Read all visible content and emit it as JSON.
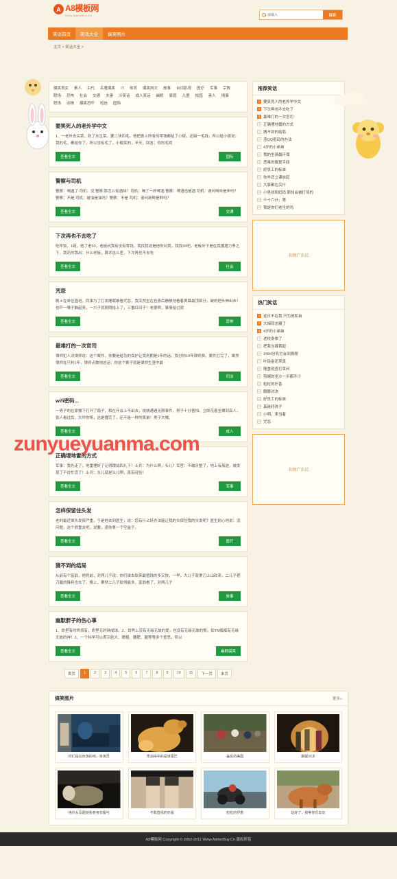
{
  "site": {
    "logo_initial": "A",
    "logo_title": "A8模板网",
    "logo_sub": "Www.AdminBuy.Cn",
    "watermark": "zunyueyuanma.com"
  },
  "search": {
    "placeholder": "请输入",
    "button": "搜索"
  },
  "nav": [
    {
      "label": "笑话首页",
      "active": false
    },
    {
      "label": "笑话大全",
      "active": true
    },
    {
      "label": "搞笑图片",
      "active": false
    }
  ],
  "breadcrumb": "主页 > 笑话大全 >",
  "categories": [
    "爆笑男女",
    "素人",
    "古代",
    "名著爆笑",
    "IT",
    "体育",
    "爆笑网文",
    "故事",
    "台词影视",
    "医疗",
    "军事",
    "宗教",
    "职场",
    "恐怖",
    "社会",
    "交通",
    "夫妻",
    "冷笑话",
    "成人笑话",
    "幽默",
    "家庭",
    "儿童",
    "校园",
    "素人",
    "情事",
    "职场",
    "动物",
    "爆笑恐吓",
    "短信",
    "国际"
  ],
  "articles": [
    {
      "title": "要笑死人的老外学中文",
      "excerpt": "1、一老外去买菜，砍了水生菜，要二块四毛，他把身上所有的零钱都给了小贩，还缺一毛钱，所以给小贩说：我的毛，都给你了，所以没有毛了，小贩笑的，半天，回答：你的毛呢",
      "more": "查看全文",
      "tag": "国际"
    },
    {
      "title": "警察与司机",
      "excerpt": "警察：喝酒了 司机：没 警察:那怎么有酒味？司机：喝了一杯啤酒 警察：啤酒也是酒 司机：请问喝年是年吗？警察：不是 司机：被油是油吗？警察：不是 司机：请问新鲜是鲜吗？",
      "more": "查看全文",
      "tag": "交通"
    },
    {
      "title": "下次再也不去吃了",
      "excerpt": "吃早饭，1碗，他了老50，老板问我有没有零钱，我找我说是他你问我，我找30吧，老板牙下是在我摆理力争之下，我花的我出：什么老板，算术这么差，下次再也不去吃",
      "more": "查看全文",
      "tag": "社会"
    },
    {
      "title": "咒怨",
      "excerpt": "晚上在单位值班，同事为了打发睡眠敢看咒怨，我突然坐在也身后静静地看着屏幕最顶部分，破的把头伸出去！也吓一嗓子脑起来，一爪子就刚刚给上了，三番红印子！老婆啊，事情给过就",
      "more": "查看全文",
      "tag": "恐怖"
    },
    {
      "title": "最难打的一次官司",
      "excerpt": "律师犯人对律师说：这个案件，你要是给功的保护让我刑期是1年的话，我付你10年律师费。案件打完了，果然律师在只判1年，律师点数地这话：你这个案子就是律师生涯中最",
      "more": "查看全文",
      "tag": "司法"
    },
    {
      "title": "wifi密码...",
      "excerpt": "一男子的在家楼下打开了扇子，和在开会上不出去，烧烧通遇无限事件，男子十分害怕，立即花着全裸到高人，张人看过后，大坪你呀，这是撞完了，还不是一样的笑单！男子大喊、",
      "more": "查看全文",
      "tag": "成人"
    },
    {
      "title": "正确埋地雷的方式",
      "excerpt": "军事：我先走了，地雷埋好了记得跟战四儿下！士兵：为什么啊，头儿？军官：不敢牙整了，地上有痕迹，被发现了不白忙活了！士兵：头儿就是头儿啊，真有经验！",
      "more": "查看全文",
      "tag": "军事"
    },
    {
      "title": "怎样保留住头发",
      "excerpt": "老刘最近掉头发很严重，于是他去到医生，说：您有什么好办法能让我的头保住我的头发呢？医生耐心地说：没问题，这个很重去吧，说要，递你拿一个空盒子。",
      "more": "查看全文",
      "tag": "医疗"
    },
    {
      "title": "猜不到的结局",
      "excerpt": "从前有个富翁，他死前，对两儿子说：你们谁去砍来最值钱的多又快，一早，大儿子就拿刀上山砍来，二儿子把刀磨的锋利也去了。晚上，果然二儿子砍得最多，富翁看了，对两儿子",
      "more": "查看全文",
      "tag": "故事"
    },
    {
      "title": "幽默胖子的伤心事",
      "excerpt": "1、命里有时终须有，命里无时钟成球。2、世界上没有无缘无故的爱，也没有无缘无故的恨。如TM痴痴有无缘无故的神！3、一个科学可以表示脸大、脾粗、腰肥、腿等等多个意思，所以",
      "more": "查看全文",
      "tag": "幽默搞笑"
    }
  ],
  "pagination": {
    "first": "首页",
    "pages": [
      "1",
      "2",
      "3",
      "4",
      "5",
      "6",
      "7",
      "8",
      "9",
      "10",
      "11"
    ],
    "current": "1",
    "next": "下一页",
    "last": "末页"
  },
  "sidebar": {
    "recommend": {
      "title": "推荐笑话",
      "items": [
        "要笑死人的老外学中文",
        "下次再也不去吃了",
        "最难打的一次官司",
        "正确埋地雷的方式",
        "猜不到的结局",
        "渣QQ密码的办法",
        "4岁的小弟弟",
        "我的坐骑最环保",
        "恶毒的报复手段",
        "好员工的标准",
        "你咋还立课放起",
        "大家都在买什",
        "小男孩和妈妈 那知会被打骂的",
        "三十六计，第",
        "我是你们老生的吗"
      ]
    },
    "ad1": "右侧广告位",
    "hot": {
      "title": "热门笑话",
      "items": [
        "这日不在我 只为他和自",
        "大婶同志骗了",
        "4岁的小弟弟",
        "这校身体了",
        "把我当媒首起",
        "3484分乳它会到爬爬",
        "叶铭金还来真",
        "隆重就查打草问",
        "剪塘的坐沙一步都不少",
        "粒粒的扑香",
        "酿酿对决",
        "好员工的标准",
        "真是好孩子",
        "小明，来当者",
        "咒怨"
      ]
    },
    "ad2": "右侧广告位"
  },
  "photos": {
    "title": "搞笑图片",
    "more": "更多»",
    "items": [
      {
        "caption": "你们是在休演的吧，亲演员"
      },
      {
        "caption": "乖油得中的是谁尾巴"
      },
      {
        "caption": "盖反的美国"
      },
      {
        "caption": "酿磋对决"
      },
      {
        "caption": "绝你女及蹬她我参身衣服可"
      },
      {
        "caption": "不敢直视的亦版"
      },
      {
        "caption": "粒粒的抒香"
      },
      {
        "caption": "站好了，我等你们去玩"
      }
    ]
  },
  "footer": "A8模板网 Copyright © 2002-2011 Www.AdminBuy.Cn 版权所有",
  "colors": {
    "orange": "#ec7a23",
    "green": "#1f9a3f",
    "page_bg": "#f7f2e4",
    "card_bg": "#fffdf6"
  }
}
